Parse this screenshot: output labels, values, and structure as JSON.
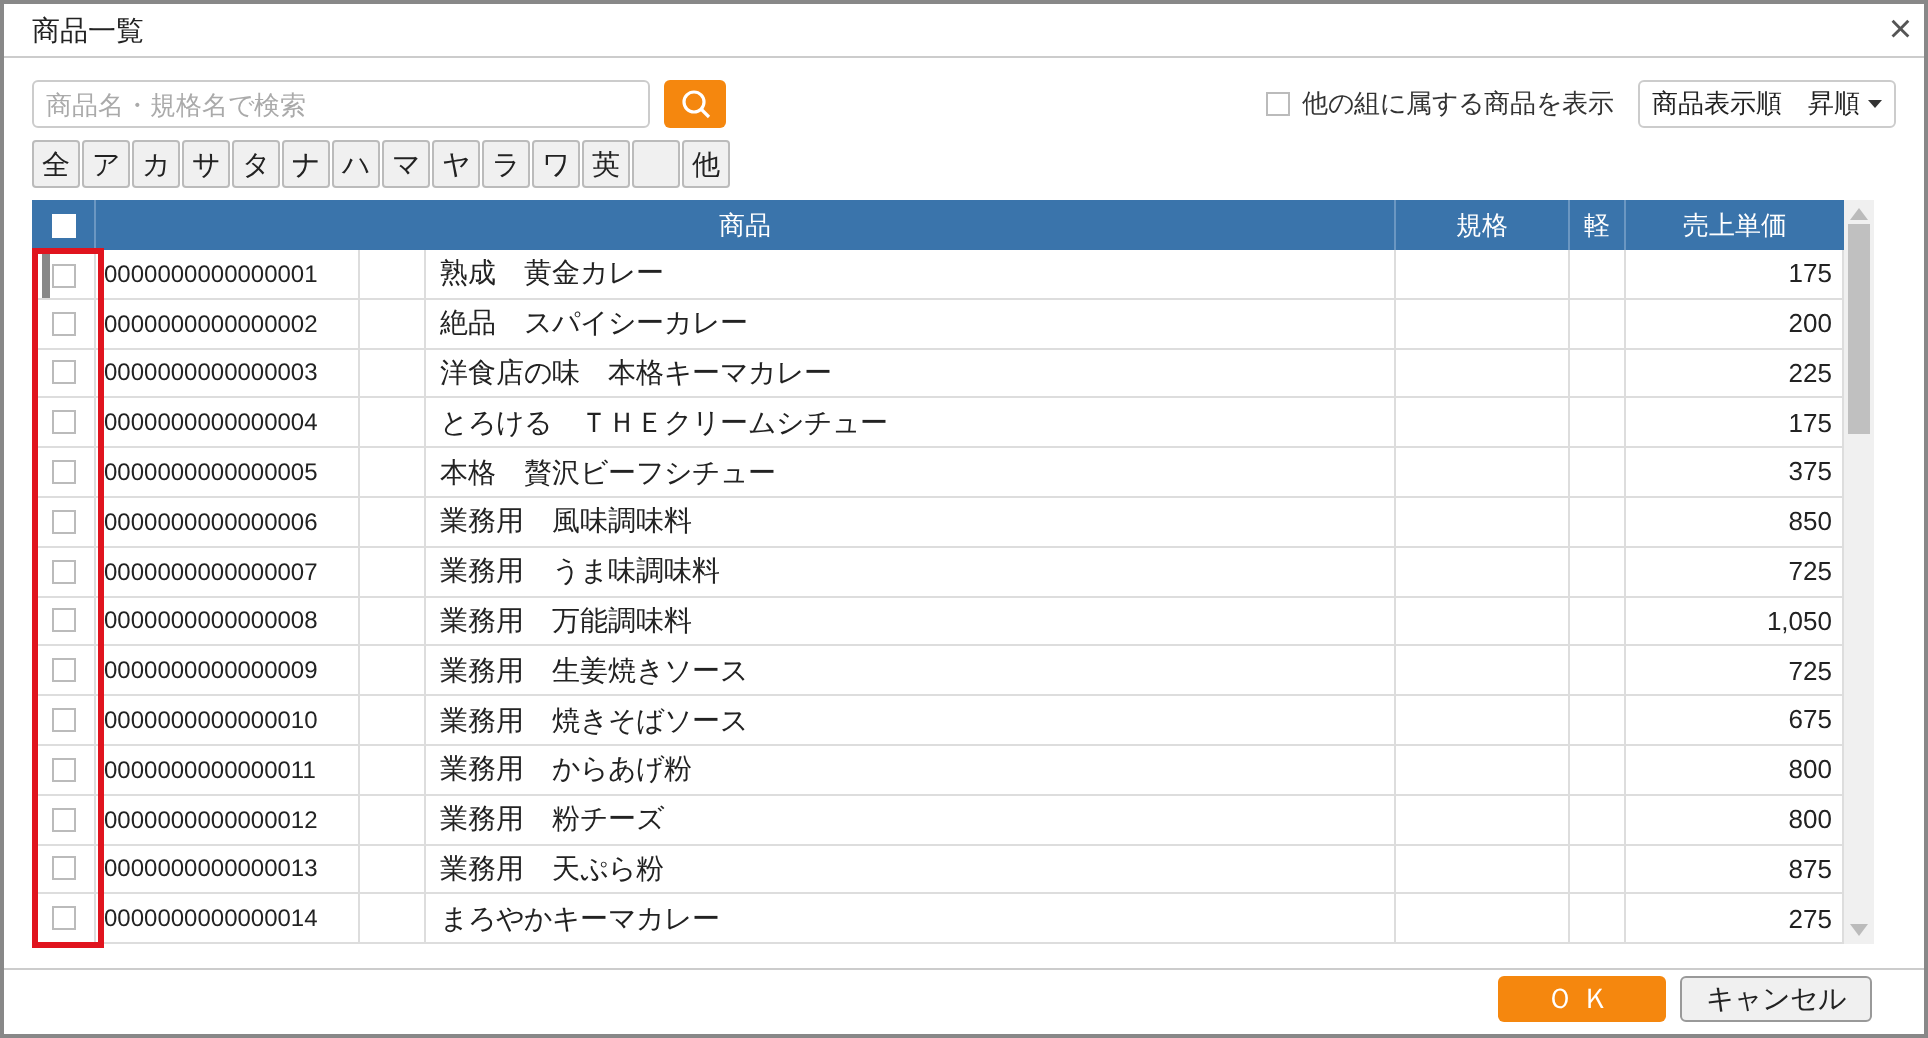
{
  "window": {
    "title": "商品一覧",
    "close": "×"
  },
  "search": {
    "placeholder": "商品名・規格名で検索"
  },
  "show_other_groups": {
    "label": "他の組に属する商品を表示",
    "checked": false
  },
  "sort": {
    "value": "商品表示順　昇順"
  },
  "kana_buttons": [
    {
      "kind": "label",
      "label": "全"
    },
    {
      "kind": "label",
      "label": "ア"
    },
    {
      "kind": "label",
      "label": "カ"
    },
    {
      "kind": "label",
      "label": "サ"
    },
    {
      "kind": "label",
      "label": "タ"
    },
    {
      "kind": "label",
      "label": "ナ"
    },
    {
      "kind": "label",
      "label": "ハ"
    },
    {
      "kind": "label",
      "label": "マ"
    },
    {
      "kind": "label",
      "label": "ヤ"
    },
    {
      "kind": "label",
      "label": "ラ"
    },
    {
      "kind": "label",
      "label": "ワ"
    },
    {
      "kind": "label",
      "label": "英"
    },
    {
      "kind": "blank"
    },
    {
      "kind": "label",
      "label": "他"
    }
  ],
  "table": {
    "select_all_checked": false,
    "columns": [
      "商品",
      "規格",
      "軽",
      "売上単価"
    ],
    "rows": [
      {
        "selected": true,
        "checked": false,
        "code": "0000000000000001",
        "name": "熟成　黄金カレー",
        "price": "175"
      },
      {
        "selected": false,
        "checked": false,
        "code": "0000000000000002",
        "name": "絶品　スパイシーカレー",
        "price": "200"
      },
      {
        "selected": false,
        "checked": false,
        "code": "0000000000000003",
        "name": "洋食店の味　本格キーマカレー",
        "price": "225"
      },
      {
        "selected": false,
        "checked": false,
        "code": "0000000000000004",
        "name": "とろける　ＴＨＥクリームシチュー",
        "price": "175"
      },
      {
        "selected": false,
        "checked": false,
        "code": "0000000000000005",
        "name": "本格　贅沢ビーフシチュー",
        "price": "375"
      },
      {
        "selected": false,
        "checked": false,
        "code": "0000000000000006",
        "name": "業務用　風味調味料",
        "price": "850"
      },
      {
        "selected": false,
        "checked": false,
        "code": "0000000000000007",
        "name": "業務用　うま味調味料",
        "price": "725"
      },
      {
        "selected": false,
        "checked": false,
        "code": "0000000000000008",
        "name": "業務用　万能調味料",
        "price": "1,050"
      },
      {
        "selected": false,
        "checked": false,
        "code": "0000000000000009",
        "name": "業務用　生姜焼きソース",
        "price": "725"
      },
      {
        "selected": false,
        "checked": false,
        "code": "0000000000000010",
        "name": "業務用　焼きそばソース",
        "price": "675"
      },
      {
        "selected": false,
        "checked": false,
        "code": "0000000000000011",
        "name": "業務用　からあげ粉",
        "price": "800"
      },
      {
        "selected": false,
        "checked": false,
        "code": "0000000000000012",
        "name": "業務用　粉チーズ",
        "price": "800"
      },
      {
        "selected": false,
        "checked": false,
        "code": "0000000000000013",
        "name": "業務用　天ぷら粉",
        "price": "875"
      },
      {
        "selected": false,
        "checked": false,
        "code": "0000000000000014",
        "name": "まろやかキーマカレー",
        "price": "275"
      }
    ]
  },
  "buttons": {
    "ok": "ＯＫ",
    "cancel": "キャンセル"
  }
}
